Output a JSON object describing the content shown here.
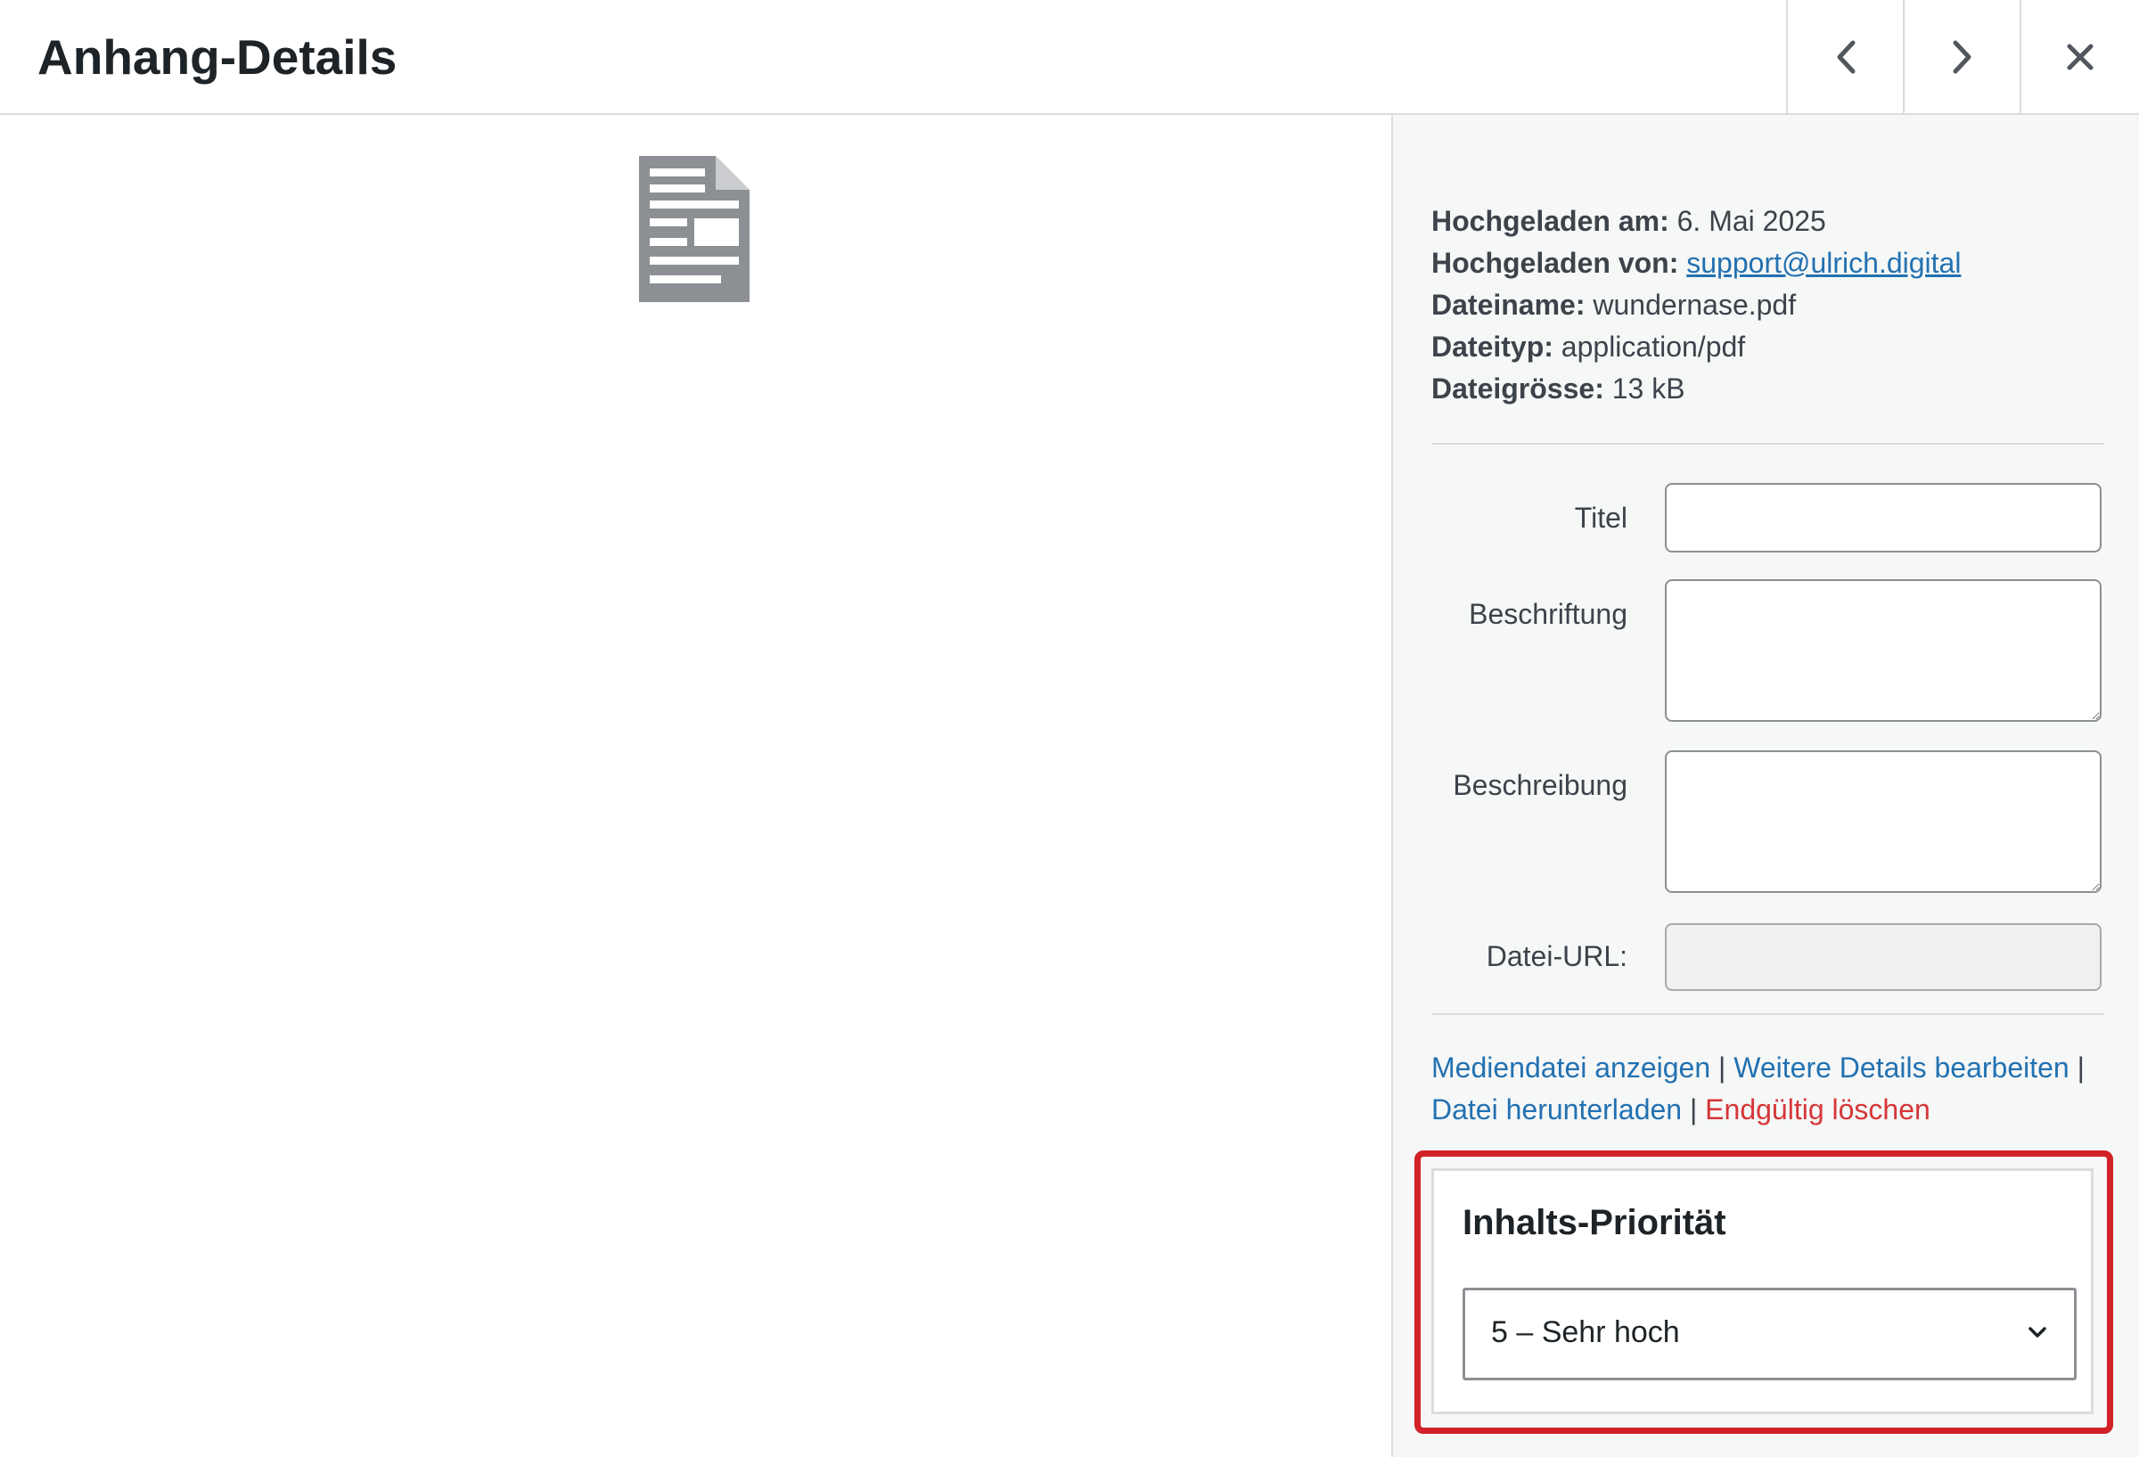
{
  "header": {
    "title": "Anhang-Details",
    "prev_icon": "chevron-left-icon",
    "next_icon": "chevron-right-icon",
    "close_icon": "close-icon"
  },
  "preview": {
    "icon": "document-icon"
  },
  "meta": {
    "uploaded_on_label": "Hochgeladen am:",
    "uploaded_on_value": "6. Mai 2025",
    "uploaded_by_label": "Hochgeladen von:",
    "uploaded_by_value": "support@ulrich.digital",
    "filename_label": "Dateiname:",
    "filename_value": "wundernase.pdf",
    "filetype_label": "Dateityp:",
    "filetype_value": "application/pdf",
    "filesize_label": "Dateigrösse:",
    "filesize_value": "13 kB"
  },
  "fields": {
    "title_label": "Titel",
    "title_value": "",
    "caption_label": "Beschriftung",
    "caption_value": "",
    "description_label": "Beschreibung",
    "description_value": "",
    "url_label": "Datei-URL:",
    "url_value": ""
  },
  "actions": {
    "view": "Mediendatei anzeigen",
    "edit": "Weitere Details bearbeiten",
    "download": "Datei herunterladen",
    "delete": "Endgültig löschen",
    "separator": "|"
  },
  "priority": {
    "title": "Inhalts-Priorität",
    "selected": "5 – Sehr hoch",
    "chevron_icon": "chevron-down-icon"
  },
  "colors": {
    "link": "#2271b1",
    "danger": "#d63638",
    "highlight": "#d22128"
  }
}
